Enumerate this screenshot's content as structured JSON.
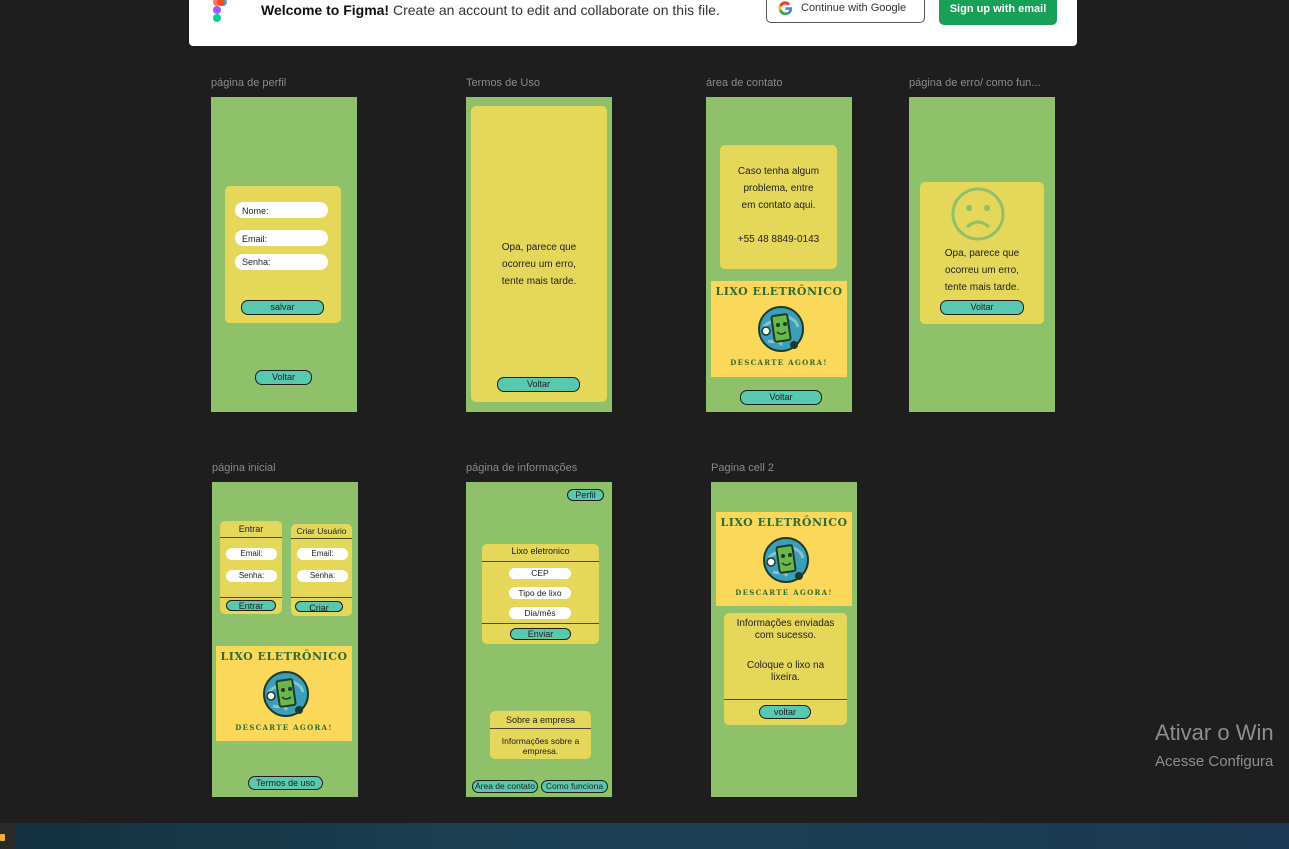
{
  "banner": {
    "title": "Welcome to Figma!",
    "message": "Create an account to edit and collaborate on this file.",
    "google_button": "Continue with Google",
    "email_button": "Sign up with email"
  },
  "frames": {
    "perfil": {
      "label": "página de perfil",
      "fields": [
        "Nome:",
        "Email:",
        "Senha:"
      ],
      "save": "salvar",
      "back": "Voltar"
    },
    "termos": {
      "label": "Termos de Uso",
      "text": [
        "Opa, parece que",
        "ocorreu um erro,",
        "tente mais tarde."
      ],
      "back": "Voltar"
    },
    "contato": {
      "label": "área de contato",
      "text": [
        "Caso tenha algum",
        "problema, entre",
        "em contato aqui."
      ],
      "phone": "+55 48 8849-0143",
      "back": "Voltar"
    },
    "erro": {
      "label": "página de erro/ como fun...",
      "text": [
        "Opa, parece que",
        "ocorreu um erro,",
        "tente mais tarde."
      ],
      "back": "Voltar"
    },
    "inicial": {
      "label": "página inicial",
      "login_title": "Entrar",
      "login_fields": [
        "Email:",
        "Senha:"
      ],
      "login_button": "Entrar",
      "create_title": "Criar Usuário",
      "create_fields": [
        "Email:",
        "Senha:"
      ],
      "create_button": "Criar",
      "terms_button": "Termos de uso"
    },
    "informacoes": {
      "label": "página de informações",
      "profile_button": "Perfil",
      "form_title": "Lixo eletronico",
      "fields": [
        "CEP",
        "Tipo de lixo",
        "Dia/mês"
      ],
      "send": "Enviar",
      "about_title": "Sobre a empresa",
      "about_text": [
        "Informações sobre a",
        "empresa."
      ],
      "contact_button": "Área de contato",
      "how_button": "Como funciona"
    },
    "cell2": {
      "label": "Pagina cell 2",
      "text1": [
        "Informações enviadas",
        "com sucesso."
      ],
      "text2": [
        "Coloque o lixo na",
        "lixeira."
      ],
      "back": "voltar"
    }
  },
  "poster": {
    "title": "LIXO ELETRÔNICO",
    "subtitle": "DESCARTE AGORA!"
  },
  "watermark": {
    "line1": "Ativar o Win",
    "line2": "Acesse Configura"
  },
  "colors": {
    "frame_green": "#8fc06a",
    "box_yellow": "#e5d75a",
    "button_teal": "#58c8ae",
    "poster_yellow": "#fbd85a",
    "figma_green": "#18a058"
  }
}
